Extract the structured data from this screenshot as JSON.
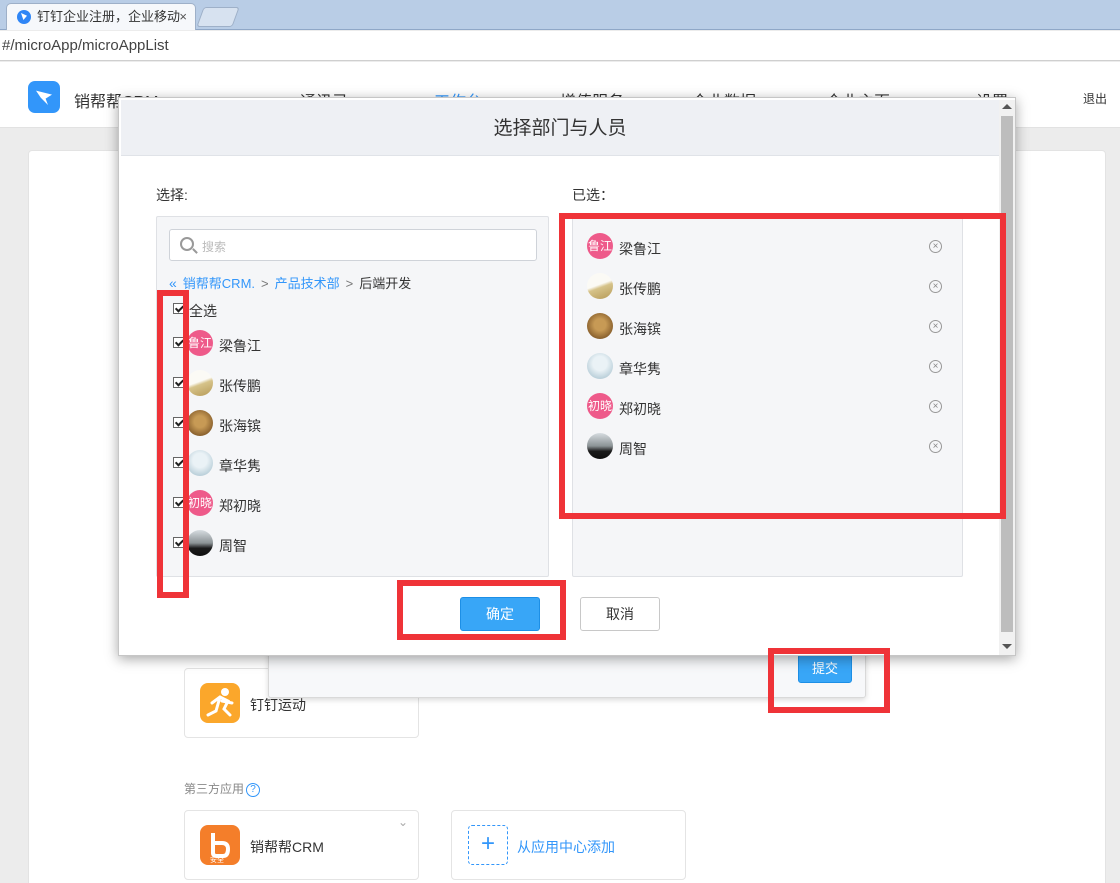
{
  "browser": {
    "tab_title": "钉钉企业注册，企业移动",
    "tab_close": "×",
    "url": "#/microApp/microAppList"
  },
  "app": {
    "brand": "销帮帮CRM",
    "nav": [
      "通讯录",
      "工作台",
      "增值服务",
      "企业数据",
      "企业主页",
      "设置"
    ],
    "active_nav": "工作台",
    "logout": "退出"
  },
  "background": {
    "tile_running": "钉钉运动",
    "third_party_label": "第三方应用",
    "help_glyph": "?",
    "tile_crm": "销帮帮CRM",
    "crm_badge": "安全",
    "add_from_center": "从应用中心添加",
    "add_glyph": "+",
    "submit": "提交"
  },
  "modal": {
    "title": "选择部门与人员",
    "select_label": "选择:",
    "selected_label": "已选：",
    "search_placeholder": "搜索",
    "breadcrumb": {
      "back": "«",
      "root": "销帮帮CRM.",
      "sep": ">",
      "dept": "产品技术部",
      "current": "后端开发"
    },
    "select_all": "全选",
    "people": [
      {
        "name": "梁鲁江",
        "avatar": "pink",
        "avatar_text": "鲁江",
        "checked": true
      },
      {
        "name": "张传鹏",
        "avatar": "moon",
        "avatar_text": "",
        "checked": true
      },
      {
        "name": "张海镔",
        "avatar": "cat",
        "avatar_text": "",
        "checked": true
      },
      {
        "name": "章华隽",
        "avatar": "baby",
        "avatar_text": "",
        "checked": true
      },
      {
        "name": "郑初晓",
        "avatar": "pink",
        "avatar_text": "初晓",
        "checked": true
      },
      {
        "name": "周智",
        "avatar": "dark",
        "avatar_text": "",
        "checked": true
      }
    ],
    "remove_glyph": "×",
    "ok": "确定",
    "cancel": "取消"
  },
  "colors": {
    "accent": "#3296fa",
    "annotation": "#ef3338",
    "avatar_pink": "#ee5a8a"
  }
}
